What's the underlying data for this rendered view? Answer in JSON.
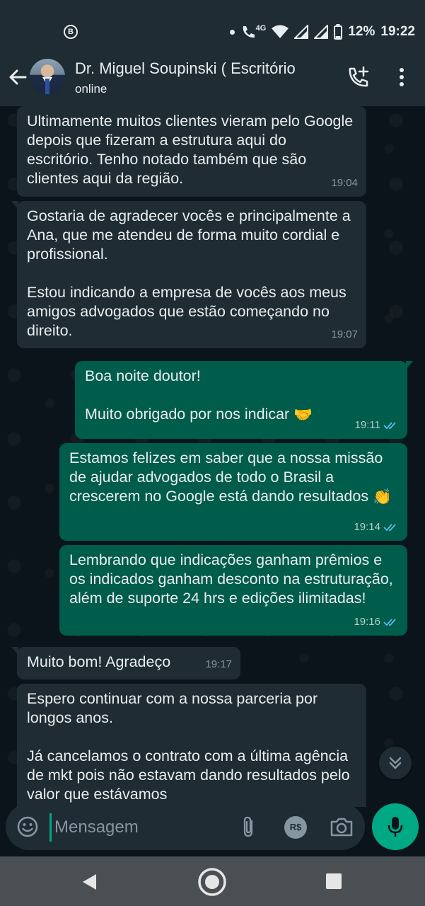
{
  "status_bar": {
    "left_icon_letter": "B",
    "network": "4G",
    "battery": "12%",
    "time": "19:22"
  },
  "header": {
    "contact_name": "Dr. Miguel Soupinski ( Escritório",
    "contact_status": "online"
  },
  "messages": [
    {
      "direction": "in",
      "text": "Ultimamente muitos clientes vieram pelo Google depois que fizeram a estrutura aqui do escritório. Tenho notado também que são clientes aqui da região.",
      "time": "19:04"
    },
    {
      "direction": "in",
      "text": "Gostaria de agradecer vocês e principalmente a Ana, que me atendeu de forma muito cordial e profissional.\n\nEstou indicando a empresa de vocês aos meus amigos advogados que estão começando no direito.",
      "time": "19:07"
    },
    {
      "direction": "out",
      "text": "Boa noite doutor!\n\nMuito obrigado por nos indicar",
      "emoji": "🤝",
      "time": "19:11"
    },
    {
      "direction": "out",
      "text": "Estamos felizes em saber que a nossa missão de ajudar advogados de todo o Brasil a crescerem no Google está dando resultados",
      "emoji": "👏",
      "time": "19:14"
    },
    {
      "direction": "out",
      "text": "Lembrando que indicações ganham prêmios e os indicados ganham desconto na estruturação, além de suporte 24 hrs e edições ilimitadas!",
      "time": "19:16"
    },
    {
      "direction": "in",
      "text": "Muito bom! Agradeço",
      "time": "19:17"
    },
    {
      "direction": "in",
      "text": "Espero continuar com a nossa parceria por longos anos.\n\nJá cancelamos o contrato com a última agência de mkt pois não estavam dando resultados pelo valor que estávamos",
      "time": ""
    }
  ],
  "composer": {
    "placeholder": "Mensagem",
    "pay_label": "R$"
  },
  "colors": {
    "incoming_bubble": "#202c33",
    "outgoing_bubble": "#005c4b",
    "accent": "#00a884",
    "read_ticks": "#53bdeb"
  }
}
